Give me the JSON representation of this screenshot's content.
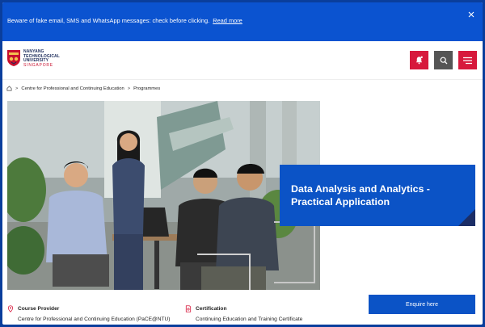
{
  "alert": {
    "message": "Beware of fake email, SMS and WhatsApp messages: check before clicking.",
    "link": "Read more",
    "close_icon": "close-icon"
  },
  "header": {
    "logo": {
      "line1": "NANYANG",
      "line2": "TECHNOLOGICAL",
      "line3": "UNIVERSITY",
      "line4": "SINGAPORE"
    },
    "buttons": [
      "bell-icon",
      "search-icon",
      "hamburger-menu-icon"
    ],
    "colors": {
      "accent": "#d7193c",
      "search_bg": "#555555"
    }
  },
  "breadcrumb": {
    "home_icon": "home-icon",
    "items": [
      "Centre for Professional and Continuing Education",
      "Programmes"
    ],
    "separator": ">"
  },
  "course": {
    "title": "Data Analysis and Analytics - Practical Application",
    "card_color": "#0b53c6"
  },
  "info": {
    "provider": {
      "label": "Course Provider",
      "value": "Centre for Professional and Continuing Education (PaCE@NTU)",
      "icon": "location-pin-icon"
    },
    "certification": {
      "label": "Certification",
      "value": "Continuing Education and Training Certificate",
      "icon": "certificate-icon"
    }
  },
  "enquire": {
    "label": "Enquire here"
  }
}
